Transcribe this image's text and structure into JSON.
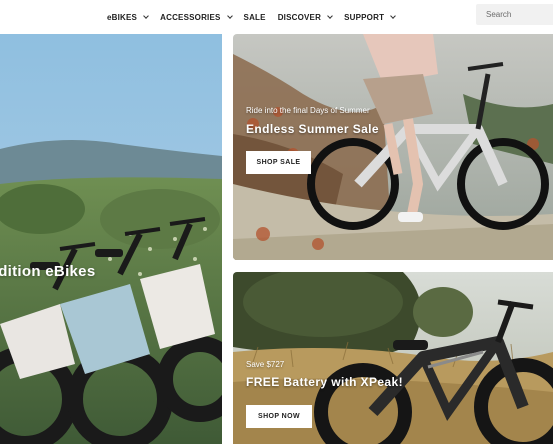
{
  "header": {
    "nav": [
      {
        "label": "eBIKES",
        "has_dropdown": true
      },
      {
        "label": "ACCESSORIES",
        "has_dropdown": true
      },
      {
        "label": "SALE",
        "has_dropdown": false
      },
      {
        "label": "DISCOVER",
        "has_dropdown": true
      },
      {
        "label": "SUPPORT",
        "has_dropdown": true
      }
    ],
    "search": {
      "placeholder": "Search"
    }
  },
  "left_banner": {
    "title": "Limited Edition eBikes"
  },
  "promo_summer": {
    "subtitle": "Ride into the final Days of Summer",
    "title": "Endless Summer Sale",
    "cta": "SHOP SALE"
  },
  "promo_battery": {
    "subtitle": "Save $727",
    "title": "FREE Battery with XPeak!",
    "cta": "SHOP NOW"
  },
  "colors": {
    "text_dark": "#1e1e1e",
    "search_bg": "#f1f1f1",
    "white": "#ffffff"
  }
}
